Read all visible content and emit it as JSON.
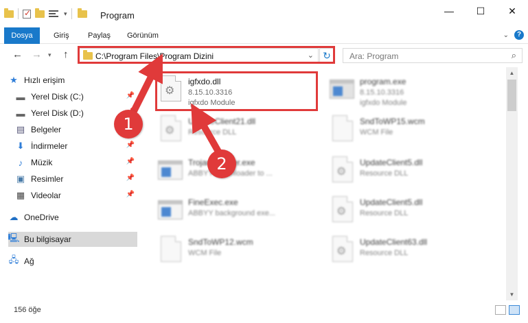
{
  "window": {
    "title": "Program",
    "controls": {
      "minimize": "—",
      "maximize": "☐",
      "close": "✕"
    }
  },
  "ribbon": {
    "tabs": [
      "Dosya",
      "Giriş",
      "Paylaş",
      "Görünüm"
    ]
  },
  "nav": {
    "address": "C:\\Program Files\\Program Dizini",
    "search_placeholder": "Ara: Program"
  },
  "sidebar": {
    "items": [
      {
        "label": "Hızlı erişim",
        "icon": "star-icon"
      },
      {
        "label": "Yerel Disk (C:)",
        "icon": "drive-icon",
        "pinned": true
      },
      {
        "label": "Yerel Disk (D:)",
        "icon": "drive-icon",
        "pinned": true
      },
      {
        "label": "Belgeler",
        "icon": "document-icon",
        "pinned": true
      },
      {
        "label": "İndirmeler",
        "icon": "download-icon",
        "pinned": true
      },
      {
        "label": "Müzik",
        "icon": "music-icon",
        "pinned": true
      },
      {
        "label": "Resimler",
        "icon": "pictures-icon",
        "pinned": true
      },
      {
        "label": "Videolar",
        "icon": "video-icon",
        "pinned": true
      },
      {
        "label": "OneDrive",
        "icon": "cloud-icon"
      },
      {
        "label": "Bu bilgisayar",
        "icon": "computer-icon",
        "selected": true
      },
      {
        "label": "Ağ",
        "icon": "network-icon"
      }
    ]
  },
  "files": [
    {
      "name": "igfxdo.dll",
      "line2": "8.15.10.3316",
      "line3": "igfxdo Module",
      "type": "dll",
      "highlighted": true
    },
    {
      "name": "program.exe",
      "line2": "8.15.10.3316",
      "line3": "igfxdo Module",
      "type": "exe-dark"
    },
    {
      "name": "UpdateClient21.dll",
      "line2": "Resource DLL",
      "line3": "",
      "type": "dll"
    },
    {
      "name": "SndToWP15.wcm",
      "line2": "WCM File",
      "line3": "",
      "type": "doc"
    },
    {
      "name": "TrojanInstaller.exe",
      "line2": "ABBYY Downloader to ...",
      "line3": "",
      "type": "exe"
    },
    {
      "name": "UpdateClient5.dll",
      "line2": "Resource DLL",
      "line3": "",
      "type": "dll"
    },
    {
      "name": "FineExec.exe",
      "line2": "ABBYY background exe...",
      "line3": "",
      "type": "exe"
    },
    {
      "name": "UpdateClient5.dll",
      "line2": "Resource DLL",
      "line3": "",
      "type": "dll"
    },
    {
      "name": "SndToWP12.wcm",
      "line2": "WCM File",
      "line3": "",
      "type": "doc"
    },
    {
      "name": "UpdateClient63.dll",
      "line2": "Resource DLL",
      "line3": "",
      "type": "dll"
    }
  ],
  "status": {
    "item_count": "156 öğe"
  },
  "annotations": {
    "callout1": "1",
    "callout2": "2",
    "highlight_color": "#e03a3a"
  },
  "colors": {
    "accent": "#1979ca",
    "folder": "#e8c24b"
  }
}
